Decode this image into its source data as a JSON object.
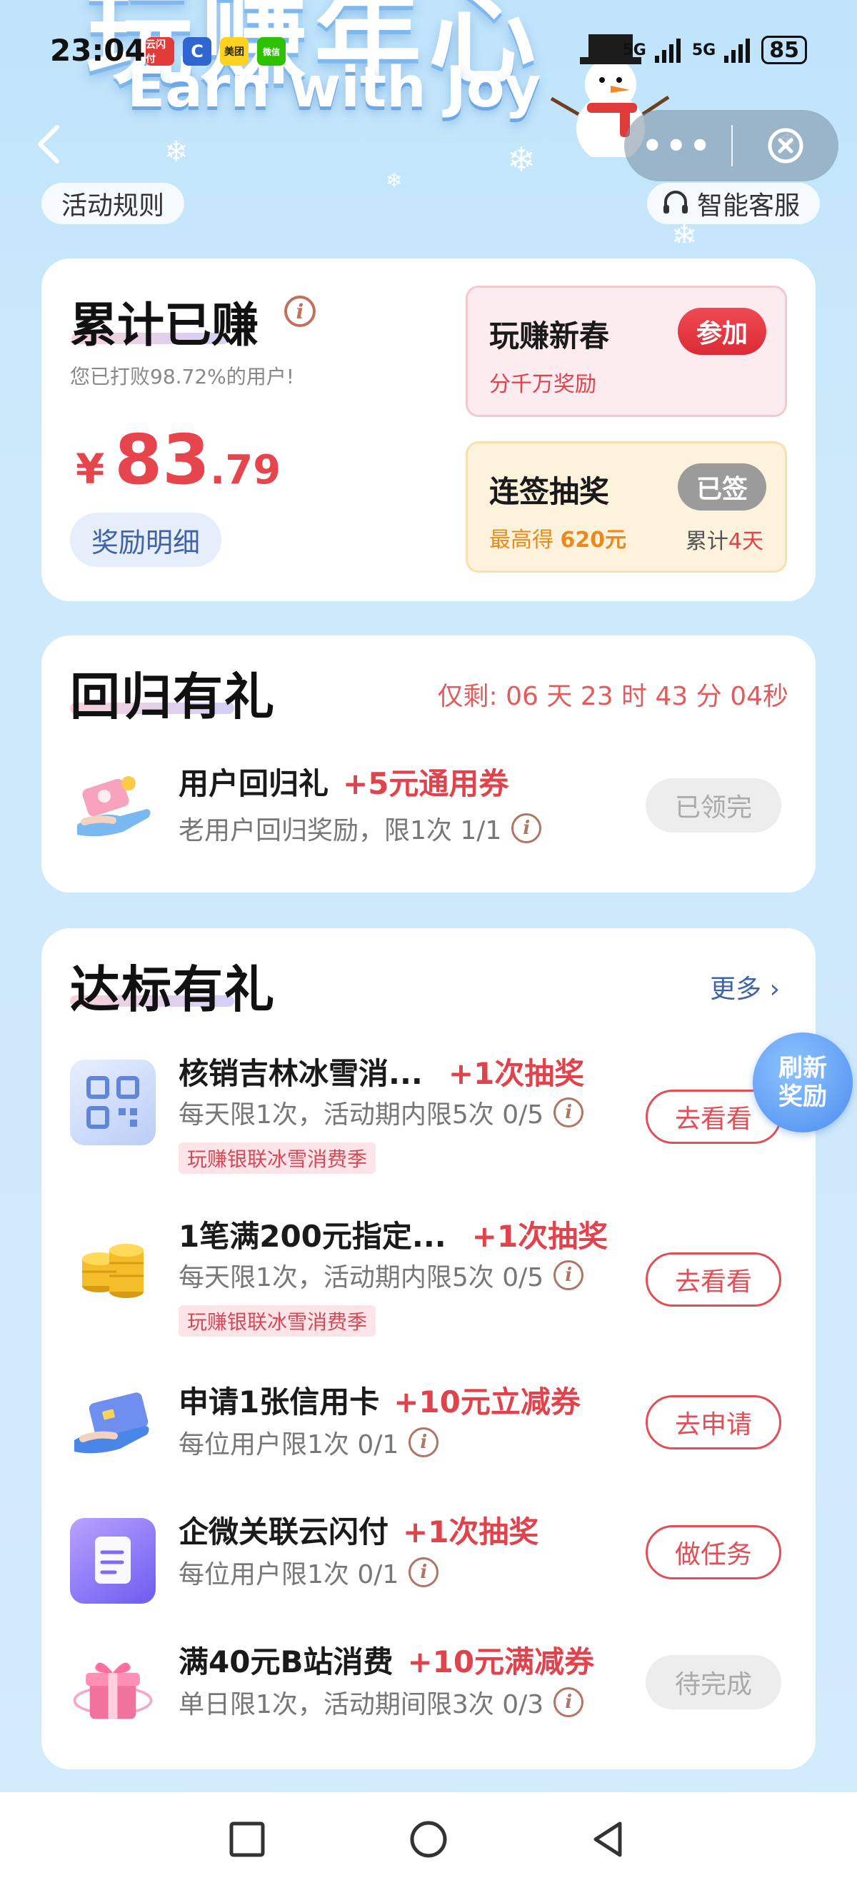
{
  "status_bar": {
    "time": "23:04",
    "apps": [
      "云闪付",
      "C",
      "美团",
      "微信"
    ],
    "signal1": "5G",
    "signal2": "5G",
    "battery": "85"
  },
  "banner": {
    "title_cn": "玩赚年心",
    "title_en": "Earn with Joy"
  },
  "nav": {
    "rules_label": "活动规则",
    "service_label": "智能客服"
  },
  "earn": {
    "title": "累计已赚",
    "rank_text": "您已打败98.72%的用户!",
    "currency": "¥",
    "amount_int": "83",
    "amount_dec": ".79",
    "detail_button": "奖励明细"
  },
  "spring": {
    "title": "玩赚新春",
    "subtitle": "分千万奖励",
    "button": "参加",
    "accent": "#e6333f"
  },
  "checkin": {
    "title": "连签抽奖",
    "subtitle_prefix": "最高得 ",
    "subtitle_value": "620元",
    "total_prefix": "累计",
    "total_value": "4天",
    "button": "已签"
  },
  "return_gift": {
    "title": "回归有礼",
    "countdown": "仅剩: 06 天 23 时 43 分 04秒",
    "task": {
      "name": "用户回归礼",
      "reward": "+5元通用券",
      "desc": "老用户回归奖励，限1次 1/1",
      "button": "已领完"
    }
  },
  "tasks": {
    "title": "达标有礼",
    "more": "更多 ›",
    "refresh_line1": "刷新",
    "refresh_line2": "奖励",
    "items": [
      {
        "name": "核销吉林冰雪消...",
        "reward": "+1次抽奖",
        "desc": "每天限1次，活动期内限5次 0/5",
        "tag": "玩赚银联冰雪消费季",
        "button": "去看看"
      },
      {
        "name": "1笔满200元指定...",
        "reward": "+1次抽奖",
        "desc": "每天限1次，活动期内限5次 0/5",
        "tag": "玩赚银联冰雪消费季",
        "button": "去看看"
      },
      {
        "name": "申请1张信用卡",
        "reward": "+10元立减券",
        "desc": "每位用户限1次 0/1",
        "button": "去申请"
      },
      {
        "name": "企微关联云闪付",
        "reward": "+1次抽奖",
        "desc": "每位用户限1次 0/1",
        "button": "做任务"
      },
      {
        "name": "满40元B站消费",
        "reward": "+10元满减券",
        "desc": "单日限1次，活动期间限3次 0/3",
        "button": "待完成"
      }
    ]
  },
  "info_glyph": "i"
}
